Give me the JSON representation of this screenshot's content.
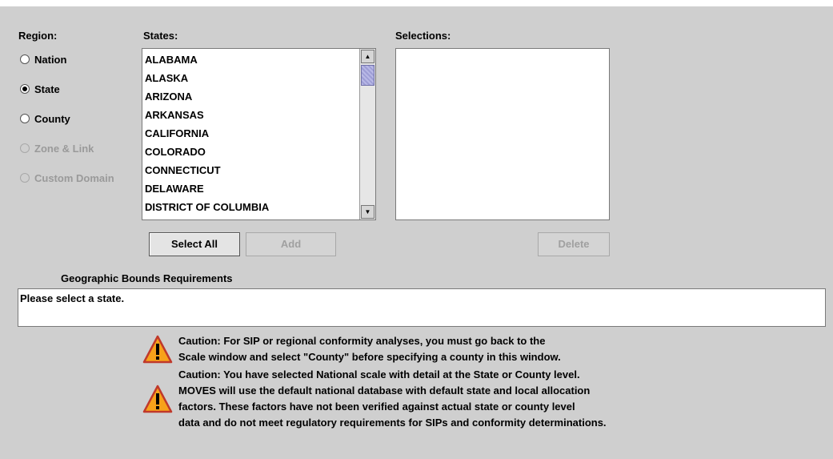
{
  "region": {
    "heading": "Region:",
    "options": [
      {
        "label": "Nation",
        "checked": false,
        "enabled": true
      },
      {
        "label": "State",
        "checked": true,
        "enabled": true
      },
      {
        "label": "County",
        "checked": false,
        "enabled": true
      },
      {
        "label": "Zone & Link",
        "checked": false,
        "enabled": false
      },
      {
        "label": "Custom Domain",
        "checked": false,
        "enabled": false
      }
    ]
  },
  "states": {
    "heading": "States:",
    "items": [
      "ALABAMA",
      "ALASKA",
      "ARIZONA",
      "ARKANSAS",
      "CALIFORNIA",
      "COLORADO",
      "CONNECTICUT",
      "DELAWARE",
      "DISTRICT OF COLUMBIA"
    ]
  },
  "selections": {
    "heading": "Selections:",
    "items": []
  },
  "buttons": {
    "select_all": "Select All",
    "add": "Add",
    "delete": "Delete"
  },
  "bounds": {
    "heading": "Geographic Bounds Requirements",
    "message": "Please select a state."
  },
  "cautions": {
    "caution1": [
      "Caution: For SIP or regional conformity analyses, you must go back to the",
      "Scale window and select \"County\" before specifying a county in this window."
    ],
    "caution2": [
      "Caution: You have selected National scale with detail at the State or County level.",
      "MOVES will use the default national database with default state and local allocation",
      "factors. These factors have not been verified against actual state or county level",
      "data and do not meet regulatory requirements for SIPs and conformity determinations."
    ]
  },
  "icons": {
    "warning": "warning-triangle-icon",
    "scroll_up": "scroll-up-arrow-icon",
    "scroll_down": "scroll-down-arrow-icon"
  },
  "colors": {
    "background": "#cfcfcf",
    "warning_fill": "#f7a21a",
    "warning_border": "#c0392b",
    "scroll_thumb": "#b8b8e6"
  }
}
